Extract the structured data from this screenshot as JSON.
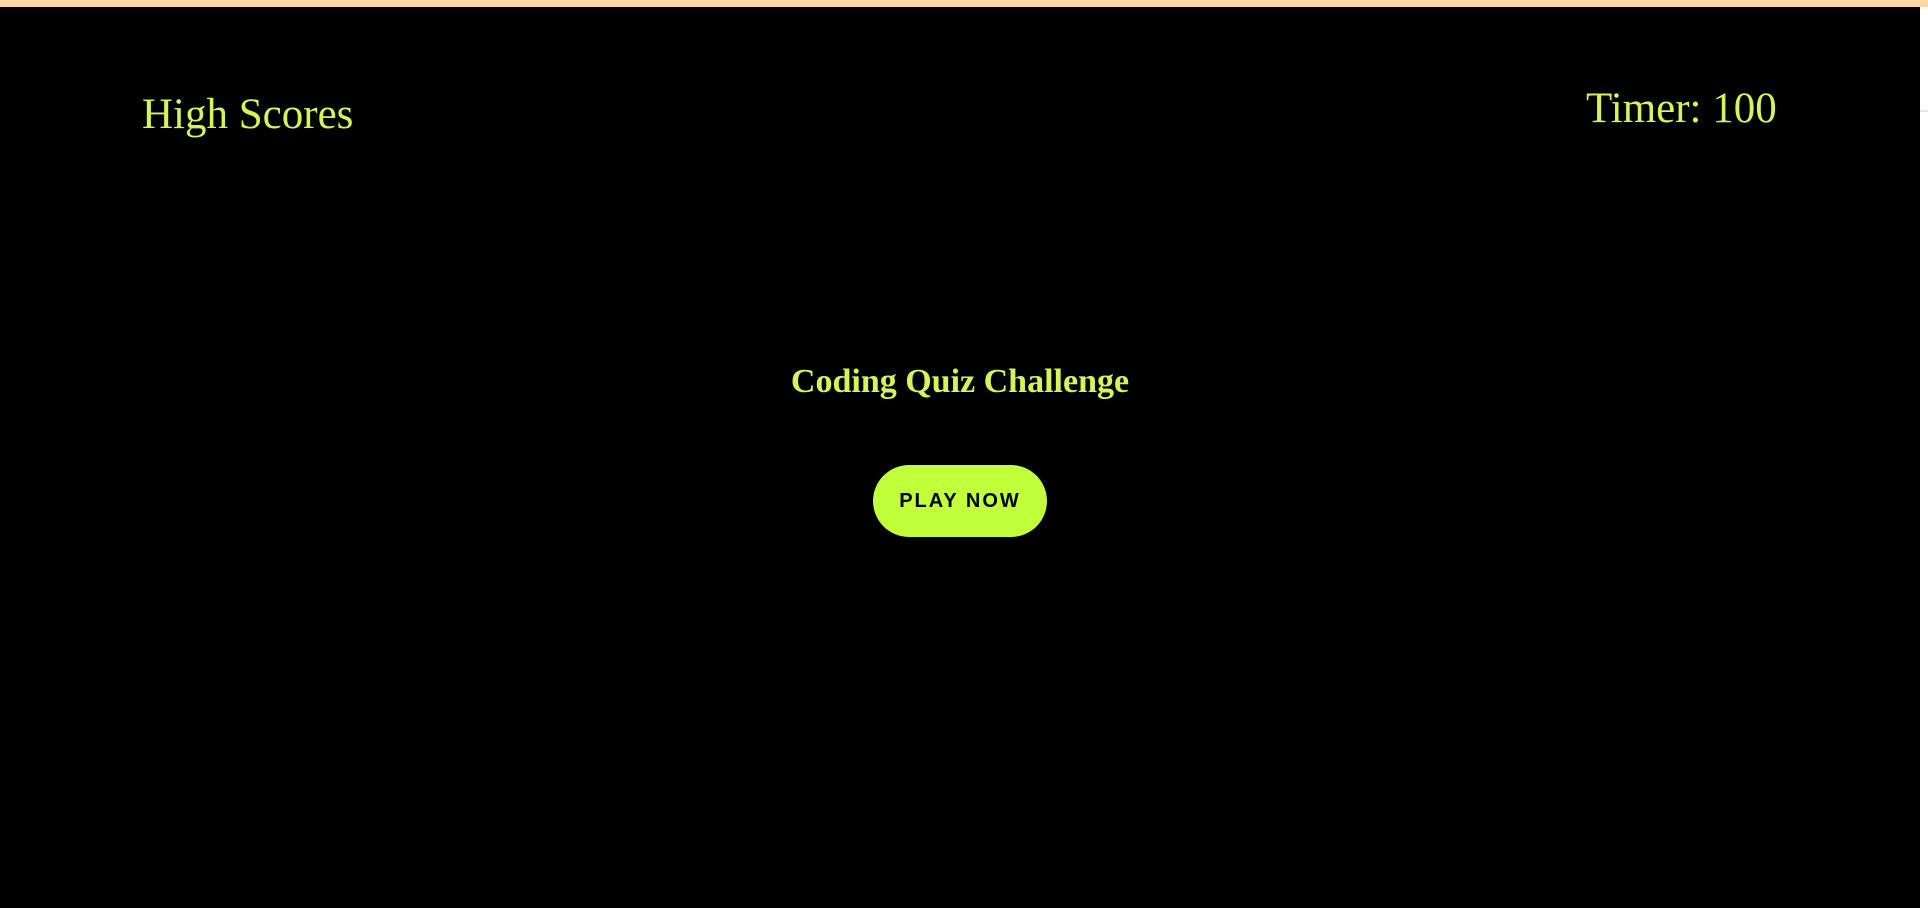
{
  "header": {
    "high_scores_label": "High Scores",
    "timer_text": "Timer: 100"
  },
  "main": {
    "title": "Coding Quiz Challenge",
    "play_button_label": "PLAY NOW"
  },
  "colors": {
    "background": "#000000",
    "accent_text": "#d6f45a",
    "button_bg": "#c1ff3b",
    "top_border": "#ffd9a3"
  }
}
